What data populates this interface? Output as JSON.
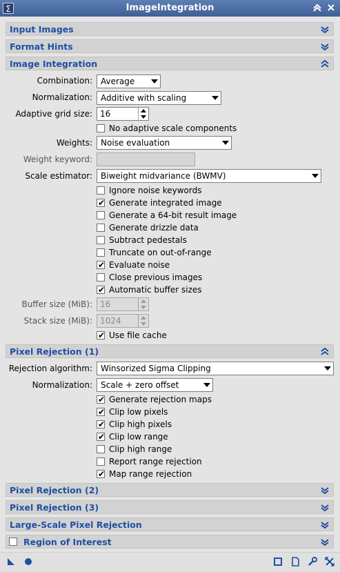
{
  "window": {
    "title": "ImageIntegration",
    "system_icon": "Σ"
  },
  "sections": {
    "input_images": "Input Images",
    "format_hints": "Format Hints",
    "image_integration": "Image Integration",
    "pixel_rejection_1": "Pixel Rejection (1)",
    "pixel_rejection_2": "Pixel Rejection (2)",
    "pixel_rejection_3": "Pixel Rejection (3)",
    "large_scale": "Large-Scale Pixel Rejection",
    "roi": "Region of Interest"
  },
  "integration": {
    "combination_label": "Combination:",
    "combination_value": "Average",
    "normalization_label": "Normalization:",
    "normalization_value": "Additive with scaling",
    "grid_label": "Adaptive grid size:",
    "grid_value": "16",
    "no_adaptive": "No adaptive scale components",
    "weights_label": "Weights:",
    "weights_value": "Noise evaluation",
    "weight_keyword_label": "Weight keyword:",
    "weight_keyword_value": "",
    "scale_label": "Scale estimator:",
    "scale_value": "Biweight midvariance (BWMV)",
    "checks": [
      {
        "label": "Ignore noise keywords",
        "checked": false
      },
      {
        "label": "Generate integrated image",
        "checked": true
      },
      {
        "label": "Generate a 64-bit result image",
        "checked": false
      },
      {
        "label": "Generate drizzle data",
        "checked": false
      },
      {
        "label": "Subtract pedestals",
        "checked": false
      },
      {
        "label": "Truncate on out-of-range",
        "checked": false
      },
      {
        "label": "Evaluate noise",
        "checked": true
      },
      {
        "label": "Close previous images",
        "checked": false
      },
      {
        "label": "Automatic buffer sizes",
        "checked": true
      }
    ],
    "buffer_label": "Buffer size (MiB):",
    "buffer_value": "16",
    "stack_label": "Stack size (MiB):",
    "stack_value": "1024",
    "file_cache": {
      "label": "Use file cache",
      "checked": true
    }
  },
  "rejection": {
    "algorithm_label": "Rejection algorithm:",
    "algorithm_value": "Winsorized Sigma Clipping",
    "normalization_label": "Normalization:",
    "normalization_value": "Scale + zero offset",
    "checks": [
      {
        "label": "Generate rejection maps",
        "checked": true
      },
      {
        "label": "Clip low pixels",
        "checked": true
      },
      {
        "label": "Clip high pixels",
        "checked": true
      },
      {
        "label": "Clip low range",
        "checked": true
      },
      {
        "label": "Clip high range",
        "checked": false
      },
      {
        "label": "Report range rejection",
        "checked": false
      },
      {
        "label": "Map range rejection",
        "checked": true
      }
    ]
  },
  "colors": {
    "section_text": "#1f4fa3",
    "titlebar": "#4a6ba2"
  }
}
